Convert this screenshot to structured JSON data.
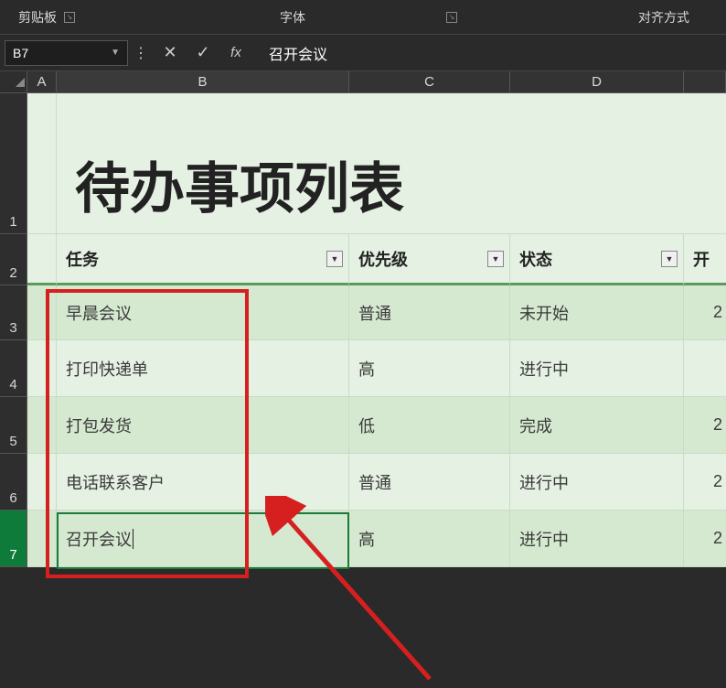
{
  "ribbon": {
    "clipboard": "剪贴板",
    "font": "字体",
    "alignment": "对齐方式"
  },
  "namebox": "B7",
  "formula_value": "召开会议",
  "columns": [
    "A",
    "B",
    "C",
    "D"
  ],
  "row_numbers": [
    "1",
    "2",
    "3",
    "4",
    "5",
    "6",
    "7"
  ],
  "title": "待办事项列表",
  "headers": {
    "task": "任务",
    "priority": "优先级",
    "status": "状态",
    "start": "开"
  },
  "rows": [
    {
      "task": "早晨会议",
      "priority": "普通",
      "status": "未开始",
      "date": "2"
    },
    {
      "task": "打印快递单",
      "priority": "高",
      "status": "进行中",
      "date": ""
    },
    {
      "task": "打包发货",
      "priority": "低",
      "status": "完成",
      "date": "2"
    },
    {
      "task": "电话联系客户",
      "priority": "普通",
      "status": "进行中",
      "date": "2"
    },
    {
      "task": "召开会议",
      "priority": "高",
      "status": "进行中",
      "date": "2"
    }
  ],
  "chart_data": {
    "type": "table",
    "title": "待办事项列表",
    "columns": [
      "任务",
      "优先级",
      "状态"
    ],
    "rows": [
      [
        "早晨会议",
        "普通",
        "未开始"
      ],
      [
        "打印快递单",
        "高",
        "进行中"
      ],
      [
        "打包发货",
        "低",
        "完成"
      ],
      [
        "电话联系客户",
        "普通",
        "进行中"
      ],
      [
        "召开会议",
        "高",
        "进行中"
      ]
    ]
  }
}
